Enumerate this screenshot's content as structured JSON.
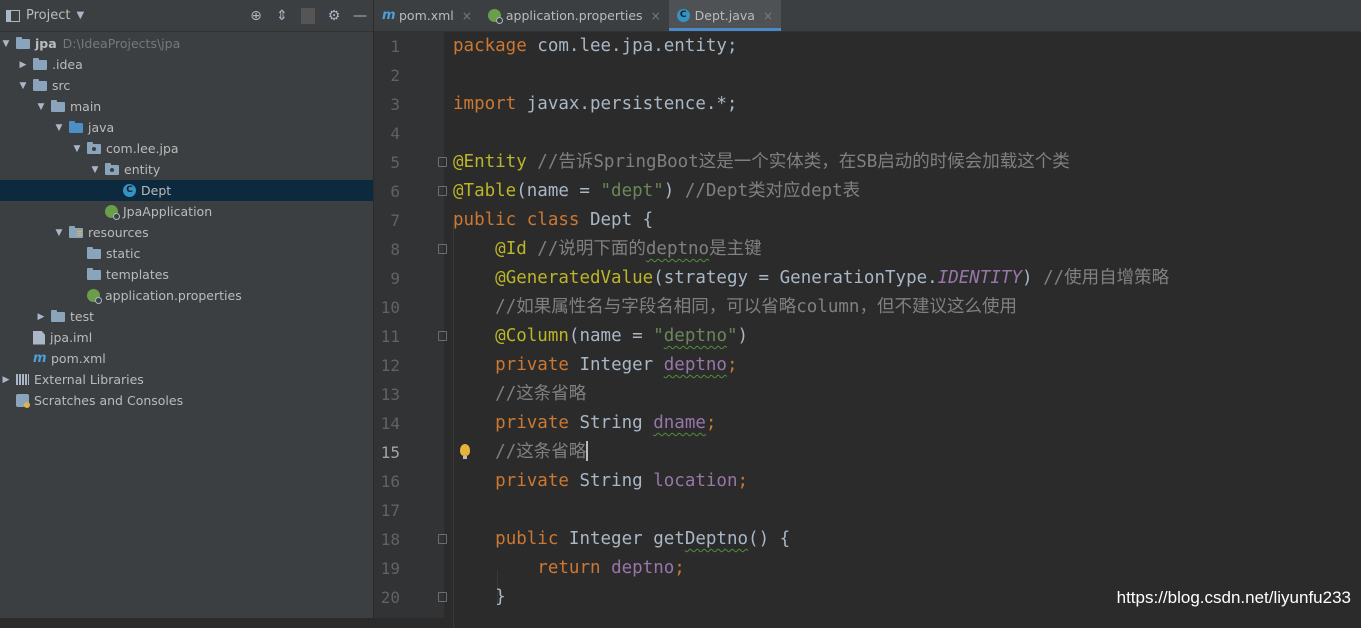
{
  "project_panel": {
    "title": "Project",
    "tree": [
      {
        "label": "jpa",
        "path": "D:\\IdeaProjects\\jpa"
      },
      {
        "label": ".idea"
      },
      {
        "label": "src"
      },
      {
        "label": "main"
      },
      {
        "label": "java"
      },
      {
        "label": "com.lee.jpa"
      },
      {
        "label": "entity"
      },
      {
        "label": "Dept"
      },
      {
        "label": "JpaApplication"
      },
      {
        "label": "resources"
      },
      {
        "label": "static"
      },
      {
        "label": "templates"
      },
      {
        "label": "application.properties"
      },
      {
        "label": "test"
      },
      {
        "label": "jpa.iml"
      },
      {
        "label": "pom.xml"
      },
      {
        "label": "External Libraries"
      },
      {
        "label": "Scratches and Consoles"
      }
    ]
  },
  "tabs": [
    {
      "label": "pom.xml"
    },
    {
      "label": "application.properties"
    },
    {
      "label": "Dept.java"
    }
  ],
  "editor": {
    "line_numbers": [
      "1",
      "2",
      "3",
      "4",
      "5",
      "6",
      "7",
      "8",
      "9",
      "10",
      "11",
      "12",
      "13",
      "14",
      "15",
      "16",
      "17",
      "18",
      "19",
      "20"
    ],
    "current_line": "15",
    "text": {
      "l1_kw": "package",
      "l1_rest": " com.lee.jpa.entity;",
      "l3_kw": "import",
      "l3_rest": " javax.persistence.*;",
      "l5_an": "@Entity",
      "l5_cm": " //告诉SpringBoot这是一个实体类，在SB启动的时候会加载这个类",
      "l6_an": "@Table",
      "l6_a": "(name = ",
      "l6_st": "\"dept\"",
      "l6_b": ") ",
      "l6_cm": "//Dept类对应dept表",
      "l7_kw": "public class",
      "l7_rest": " Dept {",
      "l8_an": "@Id",
      "l8_cm1": " //说明下面的",
      "l8_sq": "deptno",
      "l8_cm2": "是主键",
      "l9_an": "@GeneratedValue",
      "l9_a": "(strategy = GenerationType.",
      "l9_it": "IDENTITY",
      "l9_b": ") ",
      "l9_cm": "//使用自增策略",
      "l10_cm": "//如果属性名与字段名相同，可以省略column，但不建议这么使用",
      "l11_an": "@Column",
      "l11_a": "(name = ",
      "l11_st1": "\"",
      "l11_sq": "deptno",
      "l11_st2": "\"",
      "l11_b": ")",
      "l12_kw": "private",
      "l12_type": " Integer ",
      "l12_fd": "deptno",
      "l12_semi": ";",
      "l13_cm": "//这条省略",
      "l14_kw": "private",
      "l14_type": " String ",
      "l14_fd": "dname",
      "l14_semi": ";",
      "l15_cm": "//这条省略",
      "l16_kw": "private",
      "l16_type": " String ",
      "l16_fd": "location",
      "l16_semi": ";",
      "l18_kw": "public",
      "l18_type": " Integer ",
      "l18_m1": "get",
      "l18_sq": "Deptno",
      "l18_rest": "() {",
      "l19_kw": "return",
      "l19_sp": " ",
      "l19_fd": "deptno",
      "l19_semi": ";",
      "l20": "}"
    }
  },
  "watermark": "https://blog.csdn.net/liyunfu233",
  "colors": {
    "editor_bg": "#2b2b2b",
    "panel_bg": "#3c3f41",
    "keyword": "#cc7832",
    "annotation": "#bbb529",
    "string": "#6a8759",
    "comment": "#808080",
    "field": "#9876aa",
    "selection": "#0d293e"
  }
}
